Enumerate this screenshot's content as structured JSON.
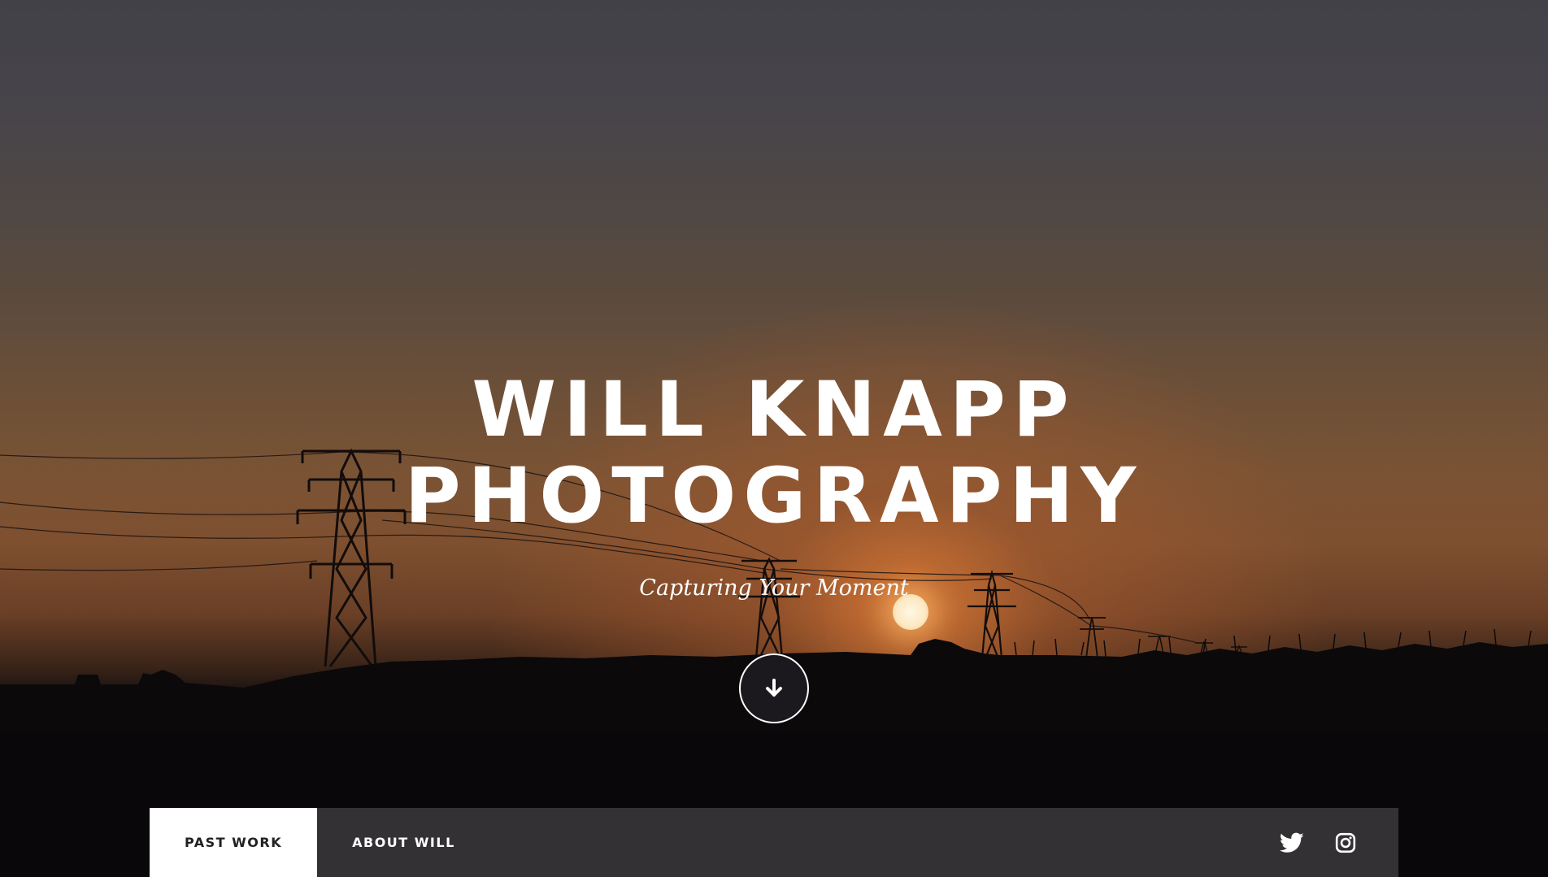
{
  "hero": {
    "title_line1": "WILL KNAPP",
    "title_line2": "PHOTOGRAPHY",
    "subtitle": "Capturing Your Moment",
    "scroll_icon": "arrow-down-icon"
  },
  "navbar": {
    "items": [
      {
        "label": "PAST WORK",
        "active": true
      },
      {
        "label": "ABOUT WILL",
        "active": false
      }
    ],
    "social": [
      {
        "icon": "twitter-icon"
      },
      {
        "icon": "instagram-icon"
      }
    ]
  },
  "colors": {
    "nav_background": "#333133",
    "nav_active_background": "#ffffff",
    "text": "#ffffff",
    "sky_top": "#424148",
    "sunset_glow": "#d67634"
  }
}
